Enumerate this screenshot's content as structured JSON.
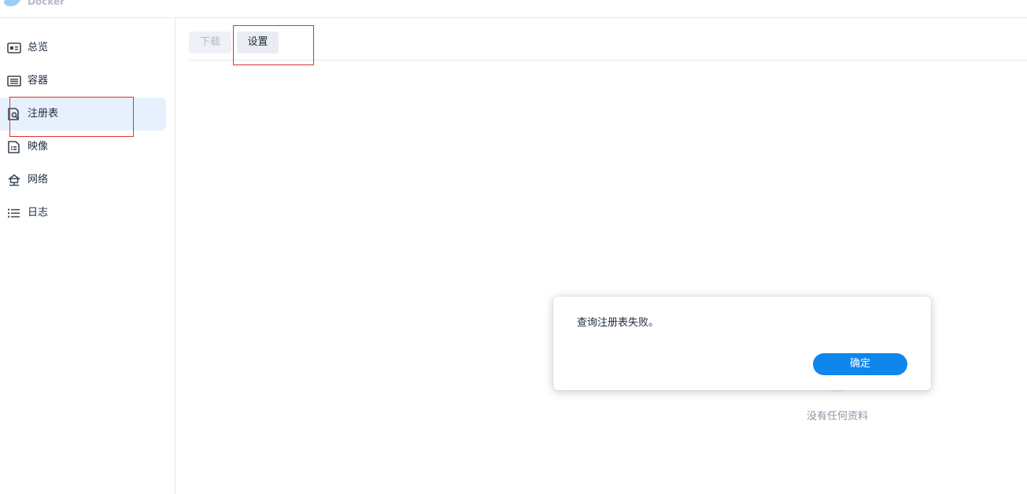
{
  "app": {
    "title": "Docker",
    "logo_icon": "docker-whale-icon"
  },
  "sidebar": {
    "items": [
      {
        "label": "总览",
        "icon": "overview-icon"
      },
      {
        "label": "容器",
        "icon": "container-icon"
      },
      {
        "label": "注册表",
        "icon": "registry-search-icon",
        "active": true
      },
      {
        "label": "映像",
        "icon": "image-icon"
      },
      {
        "label": "网络",
        "icon": "network-icon"
      },
      {
        "label": "日志",
        "icon": "log-list-icon"
      }
    ]
  },
  "main": {
    "tabs": [
      {
        "label": "下载",
        "state": "disabled"
      },
      {
        "label": "设置",
        "state": "selected"
      }
    ],
    "empty_text": "没有任何资料"
  },
  "dialog": {
    "message": "查询注册表失败。",
    "ok_label": "确定"
  },
  "colors": {
    "accent": "#0f86ec",
    "active_bg": "#e6f1fd",
    "highlight_box": "#e02f2f"
  }
}
